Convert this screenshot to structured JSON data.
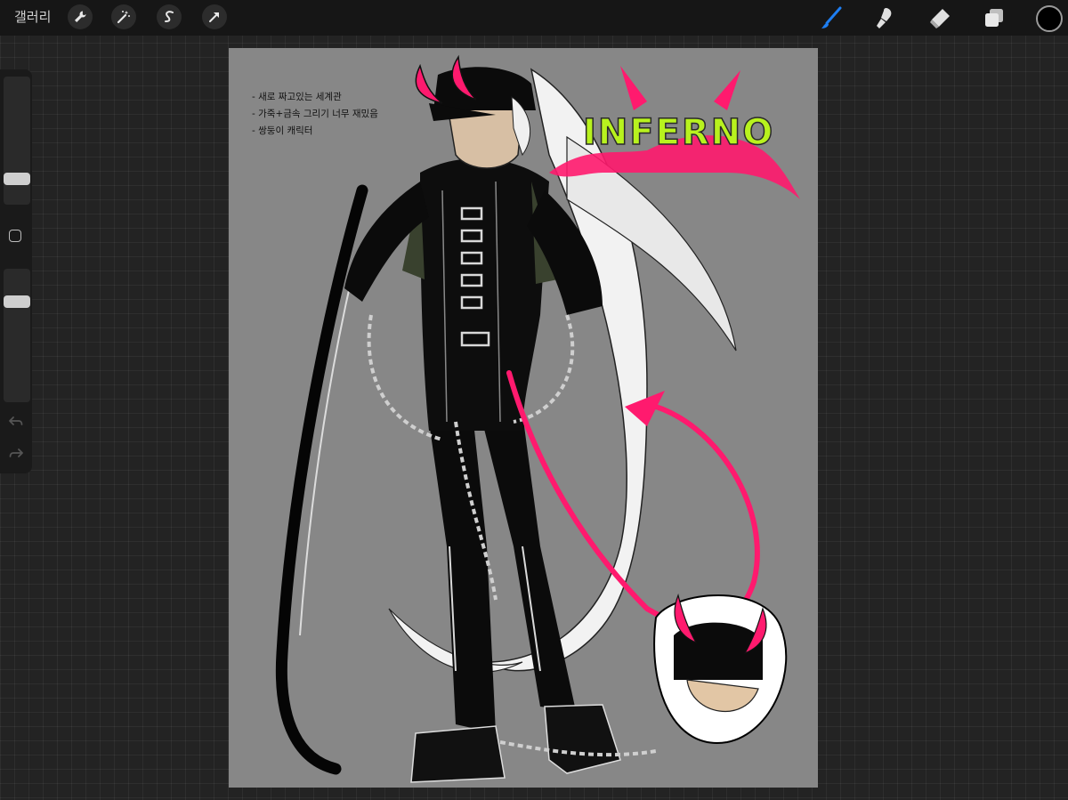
{
  "toolbar": {
    "gallery_label": "갤러리",
    "left_icons": [
      "wrench-icon",
      "magic-wand-icon",
      "selection-s-icon",
      "transform-arrow-icon"
    ],
    "right_icons": [
      "brush-icon",
      "smudge-icon",
      "eraser-icon",
      "layers-icon"
    ],
    "active_tool": "brush",
    "accent_color": "#1e7ef2",
    "current_color": "#000000"
  },
  "sidebar": {
    "brush_size_level": 0.28,
    "opacity_level": 0.25,
    "icons": [
      "modify-square-icon",
      "undo-icon",
      "redo-icon"
    ]
  },
  "canvas": {
    "background_color": "#878787",
    "notes": [
      "- 새로 짜고있는 세계관",
      "- 가죽+금속 그리기 너무 재밌음",
      "- 쌍둥이 캐릭터"
    ],
    "logo_text": "INFERNO",
    "accent_magenta": "#ff1a6e",
    "logo_green": "#b8f21e"
  }
}
